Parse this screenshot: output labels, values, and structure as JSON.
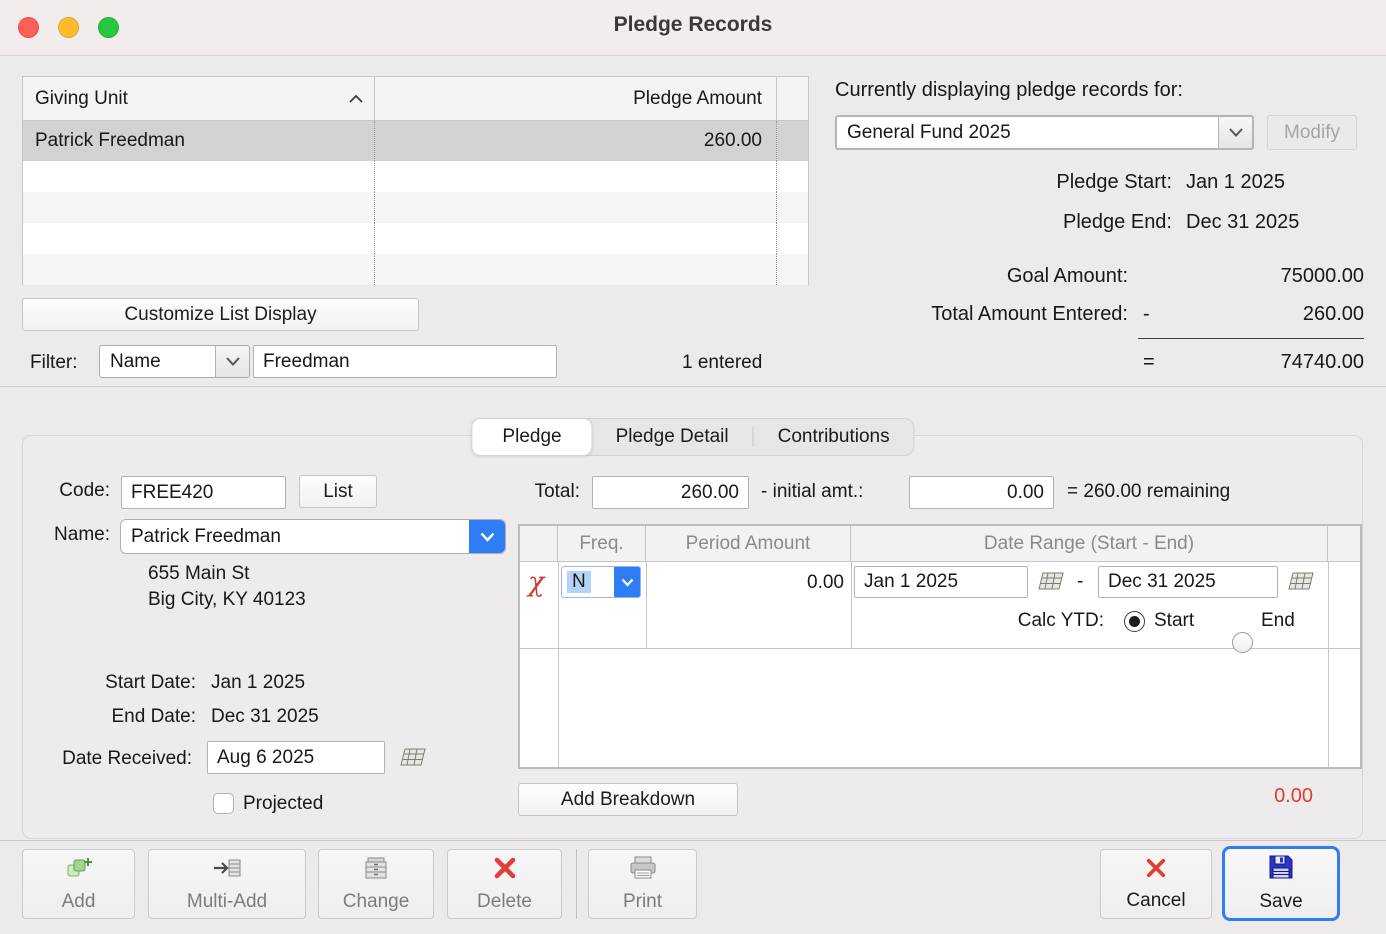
{
  "window": {
    "title": "Pledge Records"
  },
  "colors": {
    "accent_blue": "#2e7cf6",
    "alert_red": "#e23b30",
    "traffic_red": "#fe5f57",
    "traffic_yellow": "#febb2e",
    "traffic_green": "#27c73f"
  },
  "giving_list": {
    "columns": [
      "Giving Unit",
      "Pledge Amount"
    ],
    "rows": [
      {
        "name": "Patrick Freedman",
        "amount": "260.00"
      }
    ],
    "customize_button": "Customize List Display",
    "filter_label": "Filter:",
    "filter_field": "Name",
    "filter_value": "Freedman",
    "entered_count": "1 entered"
  },
  "fund_panel": {
    "heading": "Currently displaying pledge records for:",
    "fund_name": "General Fund 2025",
    "modify_button": "Modify",
    "pledge_start_label": "Pledge Start:",
    "pledge_start_value": "Jan 1 2025",
    "pledge_end_label": "Pledge End:",
    "pledge_end_value": "Dec 31 2025",
    "goal_label": "Goal Amount:",
    "goal_value": "75000.00",
    "total_entered_label": "Total Amount Entered:",
    "minus_sign": "-",
    "total_entered_value": "260.00",
    "equals_sign": "=",
    "remaining_value": "74740.00"
  },
  "tabs": {
    "pledge": "Pledge",
    "pledge_detail": "Pledge Detail",
    "contributions": "Contributions"
  },
  "pledge_form": {
    "code_label": "Code:",
    "code_value": "FREE420",
    "list_button": "List",
    "name_label": "Name:",
    "name_value": "Patrick Freedman",
    "address_line1": "655 Main St",
    "address_line2": "Big City, KY 40123",
    "start_date_label": "Start Date:",
    "start_date_value": "Jan 1 2025",
    "end_date_label": "End Date:",
    "end_date_value": "Dec 31 2025",
    "date_received_label": "Date Received:",
    "date_received_value": "Aug 6 2025",
    "projected_label": "Projected",
    "total_label": "Total:",
    "total_value": "260.00",
    "initial_amt_label": "- initial amt.:",
    "initial_amt_value": "0.00",
    "remaining_text": "= 260.00 remaining"
  },
  "breakdown": {
    "col_freq": "Freq.",
    "col_period_amount": "Period Amount",
    "col_date_range": "Date Range (Start - End)",
    "row": {
      "freq": "N",
      "period_amount": "0.00",
      "date_start": "Jan 1 2025",
      "date_end": "Dec 31 2025"
    },
    "range_dash": "-",
    "calc_ytd_label": "Calc YTD:",
    "calc_start_label": "Start",
    "calc_end_label": "End",
    "add_button": "Add Breakdown",
    "total_value": "0.00"
  },
  "toolbar": {
    "add": "Add",
    "multi_add": "Multi-Add",
    "change": "Change",
    "delete": "Delete",
    "print": "Print",
    "cancel": "Cancel",
    "save": "Save"
  }
}
